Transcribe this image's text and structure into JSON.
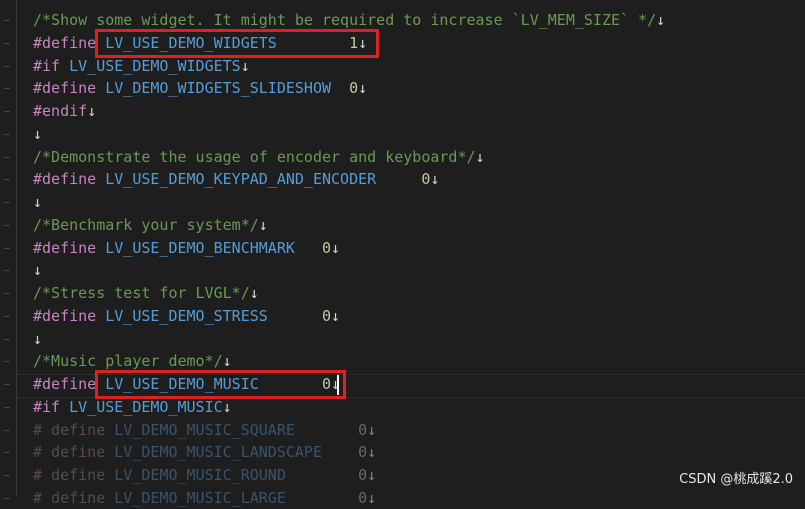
{
  "lines": [
    {
      "parts": [
        {
          "t": "/*Show some widget. It might be required to increase `LV_MEM_SIZE` */",
          "c": "com"
        },
        {
          "t": "↓",
          "c": "crlf"
        }
      ]
    },
    {
      "parts": [
        {
          "t": "#define",
          "c": "kw"
        },
        {
          "t": " LV_USE_DEMO_WIDGETS        ",
          "c": "mac"
        },
        {
          "t": "1",
          "c": "num"
        },
        {
          "t": "↓",
          "c": "crlf"
        }
      ]
    },
    {
      "parts": [
        {
          "t": "#if",
          "c": "kw"
        },
        {
          "t": " LV_USE_DEMO_WIDGETS",
          "c": "mac"
        },
        {
          "t": "↓",
          "c": "crlf"
        }
      ]
    },
    {
      "parts": [
        {
          "t": "#define",
          "c": "kw"
        },
        {
          "t": " LV_DEMO_WIDGETS_SLIDESHOW  ",
          "c": "mac"
        },
        {
          "t": "0",
          "c": "num"
        },
        {
          "t": "↓",
          "c": "crlf"
        }
      ]
    },
    {
      "parts": [
        {
          "t": "#endif",
          "c": "kw"
        },
        {
          "t": "↓",
          "c": "crlf"
        }
      ]
    },
    {
      "parts": [
        {
          "t": "↓",
          "c": "crlf"
        }
      ]
    },
    {
      "parts": [
        {
          "t": "/*Demonstrate the usage of encoder and keyboard*/",
          "c": "com"
        },
        {
          "t": "↓",
          "c": "crlf"
        }
      ]
    },
    {
      "parts": [
        {
          "t": "#define",
          "c": "kw"
        },
        {
          "t": " LV_USE_DEMO_KEYPAD_AND_ENCODER     ",
          "c": "mac"
        },
        {
          "t": "0",
          "c": "num"
        },
        {
          "t": "↓",
          "c": "crlf"
        }
      ]
    },
    {
      "parts": [
        {
          "t": "↓",
          "c": "crlf"
        }
      ]
    },
    {
      "parts": [
        {
          "t": "/*Benchmark your system*/",
          "c": "com"
        },
        {
          "t": "↓",
          "c": "crlf"
        }
      ]
    },
    {
      "parts": [
        {
          "t": "#define",
          "c": "kw"
        },
        {
          "t": " LV_USE_DEMO_BENCHMARK   ",
          "c": "mac"
        },
        {
          "t": "0",
          "c": "num"
        },
        {
          "t": "↓",
          "c": "crlf"
        }
      ]
    },
    {
      "parts": [
        {
          "t": "↓",
          "c": "crlf"
        }
      ]
    },
    {
      "parts": [
        {
          "t": "/*Stress test for LVGL*/",
          "c": "com"
        },
        {
          "t": "↓",
          "c": "crlf"
        }
      ]
    },
    {
      "parts": [
        {
          "t": "#define",
          "c": "kw"
        },
        {
          "t": " LV_USE_DEMO_STRESS      ",
          "c": "mac"
        },
        {
          "t": "0",
          "c": "num"
        },
        {
          "t": "↓",
          "c": "crlf"
        }
      ]
    },
    {
      "parts": [
        {
          "t": "↓",
          "c": "crlf"
        }
      ]
    },
    {
      "parts": [
        {
          "t": "/*Music player demo*/",
          "c": "com"
        },
        {
          "t": "↓",
          "c": "crlf"
        }
      ]
    },
    {
      "parts": [
        {
          "t": "#define",
          "c": "kw"
        },
        {
          "t": " LV_USE_DEMO_MUSIC       ",
          "c": "mac"
        },
        {
          "t": "0",
          "c": "num"
        },
        {
          "t": "↓",
          "c": "crlf"
        }
      ]
    },
    {
      "parts": [
        {
          "t": "#if",
          "c": "kw"
        },
        {
          "t": " LV_USE_DEMO_MUSIC",
          "c": "mac"
        },
        {
          "t": "↓",
          "c": "crlf"
        }
      ]
    },
    {
      "dim": true,
      "parts": [
        {
          "t": "# define",
          "c": "kw"
        },
        {
          "t": " LV_DEMO_MUSIC_SQUARE       ",
          "c": "mac"
        },
        {
          "t": "0",
          "c": "num"
        },
        {
          "t": "↓",
          "c": "crlf"
        }
      ]
    },
    {
      "dim": true,
      "parts": [
        {
          "t": "# define",
          "c": "kw"
        },
        {
          "t": " LV_DEMO_MUSIC_LANDSCAPE    ",
          "c": "mac"
        },
        {
          "t": "0",
          "c": "num"
        },
        {
          "t": "↓",
          "c": "crlf"
        }
      ]
    },
    {
      "dim": true,
      "parts": [
        {
          "t": "# define",
          "c": "kw"
        },
        {
          "t": " LV_DEMO_MUSIC_ROUND        ",
          "c": "mac"
        },
        {
          "t": "0",
          "c": "num"
        },
        {
          "t": "↓",
          "c": "crlf"
        }
      ]
    },
    {
      "dim": true,
      "parts": [
        {
          "t": "# define",
          "c": "kw"
        },
        {
          "t": " LV_DEMO_MUSIC_LARGE        ",
          "c": "mac"
        },
        {
          "t": "0",
          "c": "num"
        },
        {
          "t": "↓",
          "c": "crlf"
        }
      ]
    }
  ],
  "watermark": "CSDN @桃成蹊2.0",
  "highlight_color": "#e02020"
}
